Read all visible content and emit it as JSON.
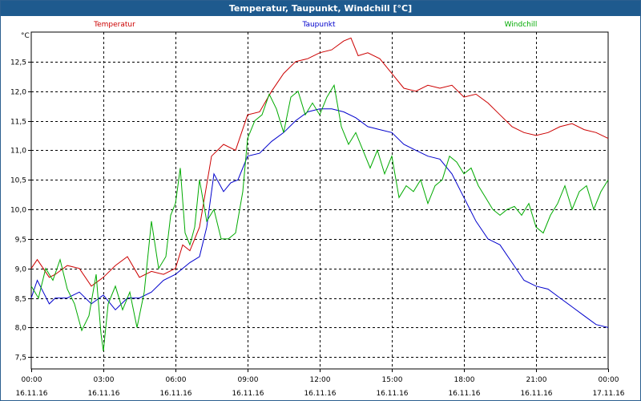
{
  "window": {
    "title": "Temperatur, Taupunkt, Windchill [°C]"
  },
  "chart_data": {
    "type": "line",
    "title": "Temperatur, Taupunkt, Windchill [°C]",
    "ylabel": "°C",
    "xlabel": "",
    "ylim": [
      7.3,
      13.0
    ],
    "xlim": [
      0,
      24
    ],
    "grid": true,
    "legend_position": "top",
    "y_ticks": [
      7.5,
      8.0,
      8.5,
      9.0,
      9.5,
      10.0,
      10.5,
      11.0,
      11.5,
      12.0,
      12.5
    ],
    "y_tick_labels": [
      "7,5",
      "8,0",
      "8,5",
      "9,0",
      "9,5",
      "10,0",
      "10,5",
      "11,0",
      "11,5",
      "12,0",
      "12,5"
    ],
    "x_ticks": [
      0,
      3,
      6,
      9,
      12,
      15,
      18,
      21,
      24
    ],
    "x_tick_labels": [
      {
        "time": "00:00",
        "date": "16.11.16"
      },
      {
        "time": "03:00",
        "date": "16.11.16"
      },
      {
        "time": "06:00",
        "date": "16.11.16"
      },
      {
        "time": "09:00",
        "date": "16.11.16"
      },
      {
        "time": "12:00",
        "date": "16.11.16"
      },
      {
        "time": "15:00",
        "date": "16.11.16"
      },
      {
        "time": "18:00",
        "date": "16.11.16"
      },
      {
        "time": "21:00",
        "date": "16.11.16"
      },
      {
        "time": "00:00",
        "date": "17.11.16"
      }
    ],
    "series": [
      {
        "name": "Temperatur",
        "color": "#cc0000",
        "x": [
          0,
          0.25,
          0.5,
          0.75,
          1.0,
          1.5,
          2.0,
          2.5,
          3.0,
          3.5,
          4.0,
          4.5,
          5.0,
          5.5,
          6.0,
          6.3,
          6.6,
          7.0,
          7.5,
          8.0,
          8.5,
          9.0,
          9.5,
          10.0,
          10.5,
          11.0,
          11.5,
          12.0,
          12.5,
          13.0,
          13.3,
          13.6,
          14.0,
          14.5,
          15.0,
          15.5,
          16.0,
          16.5,
          17.0,
          17.5,
          18.0,
          18.5,
          19.0,
          19.5,
          20.0,
          20.5,
          21.0,
          21.5,
          22.0,
          22.5,
          23.0,
          23.5,
          24.0
        ],
        "values": [
          9.0,
          9.15,
          9.0,
          8.85,
          8.9,
          9.05,
          9.0,
          8.7,
          8.85,
          9.05,
          9.2,
          8.85,
          8.95,
          8.9,
          9.0,
          9.4,
          9.3,
          9.7,
          10.9,
          11.1,
          11.0,
          11.6,
          11.65,
          12.0,
          12.3,
          12.5,
          12.55,
          12.65,
          12.7,
          12.85,
          12.9,
          12.6,
          12.65,
          12.55,
          12.3,
          12.05,
          12.0,
          12.1,
          12.05,
          12.1,
          11.9,
          11.95,
          11.8,
          11.6,
          11.4,
          11.3,
          11.25,
          11.3,
          11.4,
          11.45,
          11.35,
          11.3,
          11.2
        ]
      },
      {
        "name": "Taupunkt",
        "color": "#0000cc",
        "x": [
          0,
          0.25,
          0.5,
          0.75,
          1.0,
          1.5,
          2.0,
          2.5,
          3.0,
          3.5,
          4.0,
          4.5,
          5.0,
          5.5,
          6.0,
          6.3,
          6.6,
          7.0,
          7.3,
          7.6,
          8.0,
          8.3,
          8.6,
          9.0,
          9.5,
          10.0,
          10.5,
          11.0,
          11.5,
          12.0,
          12.5,
          13.0,
          13.5,
          14.0,
          14.5,
          15.0,
          15.5,
          16.0,
          16.5,
          17.0,
          17.5,
          18.0,
          18.5,
          19.0,
          19.5,
          20.0,
          20.5,
          21.0,
          21.5,
          22.0,
          22.5,
          23.0,
          23.5,
          24.0
        ],
        "values": [
          8.5,
          8.8,
          8.6,
          8.4,
          8.5,
          8.5,
          8.6,
          8.4,
          8.55,
          8.3,
          8.5,
          8.5,
          8.6,
          8.8,
          8.9,
          9.0,
          9.1,
          9.2,
          9.7,
          10.6,
          10.3,
          10.45,
          10.5,
          10.9,
          10.95,
          11.15,
          11.3,
          11.5,
          11.65,
          11.7,
          11.7,
          11.65,
          11.55,
          11.4,
          11.35,
          11.3,
          11.1,
          11.0,
          10.9,
          10.85,
          10.6,
          10.2,
          9.8,
          9.5,
          9.4,
          9.1,
          8.8,
          8.7,
          8.65,
          8.5,
          8.35,
          8.2,
          8.05,
          8.0
        ]
      },
      {
        "name": "Windchill",
        "color": "#00aa00",
        "x": [
          0,
          0.3,
          0.6,
          0.9,
          1.2,
          1.5,
          1.8,
          2.1,
          2.4,
          2.7,
          2.9,
          3.0,
          3.2,
          3.5,
          3.8,
          4.1,
          4.4,
          4.7,
          5.0,
          5.3,
          5.6,
          5.8,
          6.0,
          6.2,
          6.4,
          6.6,
          6.8,
          7.0,
          7.3,
          7.6,
          7.9,
          8.2,
          8.5,
          8.8,
          9.0,
          9.3,
          9.6,
          9.9,
          10.2,
          10.5,
          10.8,
          11.1,
          11.4,
          11.7,
          12.0,
          12.3,
          12.6,
          12.9,
          13.2,
          13.5,
          13.8,
          14.1,
          14.4,
          14.7,
          15.0,
          15.3,
          15.6,
          15.9,
          16.2,
          16.5,
          16.8,
          17.1,
          17.4,
          17.7,
          18.0,
          18.3,
          18.6,
          18.9,
          19.2,
          19.5,
          19.8,
          20.1,
          20.4,
          20.7,
          21.0,
          21.3,
          21.6,
          21.9,
          22.2,
          22.5,
          22.8,
          23.1,
          23.4,
          23.7,
          24.0
        ],
        "values": [
          8.7,
          8.5,
          9.0,
          8.8,
          9.15,
          8.65,
          8.4,
          7.95,
          8.2,
          8.9,
          7.9,
          7.6,
          8.4,
          8.7,
          8.3,
          8.6,
          8.0,
          8.6,
          9.8,
          9.0,
          9.2,
          9.9,
          10.1,
          10.7,
          9.6,
          9.4,
          9.7,
          10.5,
          9.8,
          10.0,
          9.5,
          9.5,
          9.6,
          10.3,
          11.2,
          11.5,
          11.6,
          11.95,
          11.7,
          11.3,
          11.9,
          12.0,
          11.6,
          11.8,
          11.6,
          11.9,
          12.1,
          11.4,
          11.1,
          11.3,
          11.0,
          10.7,
          11.0,
          10.6,
          10.9,
          10.2,
          10.4,
          10.3,
          10.5,
          10.1,
          10.4,
          10.5,
          10.9,
          10.8,
          10.6,
          10.7,
          10.4,
          10.2,
          10.0,
          9.9,
          10.0,
          10.05,
          9.9,
          10.1,
          9.7,
          9.6,
          9.9,
          10.1,
          10.4,
          10.0,
          10.3,
          10.4,
          10.0,
          10.3,
          10.5
        ]
      }
    ]
  }
}
